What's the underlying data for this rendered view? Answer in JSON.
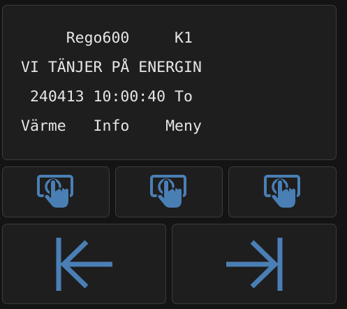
{
  "display": {
    "lines": [
      "     Rego600     K1",
      "VI TÄNJER PÅ ENERGIN",
      " 240413 10:00:40 To",
      "Värme   Info    Meny"
    ]
  },
  "colors": {
    "background": "#141414",
    "panel": "#1e1e1e",
    "border": "#3c3c3c",
    "text": "#e6e6e6",
    "accent": "#4a7fb5"
  },
  "buttons": {
    "soft": [
      {
        "icon": "touch-icon"
      },
      {
        "icon": "touch-icon"
      },
      {
        "icon": "touch-icon"
      }
    ],
    "nav": [
      {
        "icon": "arrow-left-bar-icon"
      },
      {
        "icon": "arrow-right-bar-icon"
      }
    ]
  }
}
